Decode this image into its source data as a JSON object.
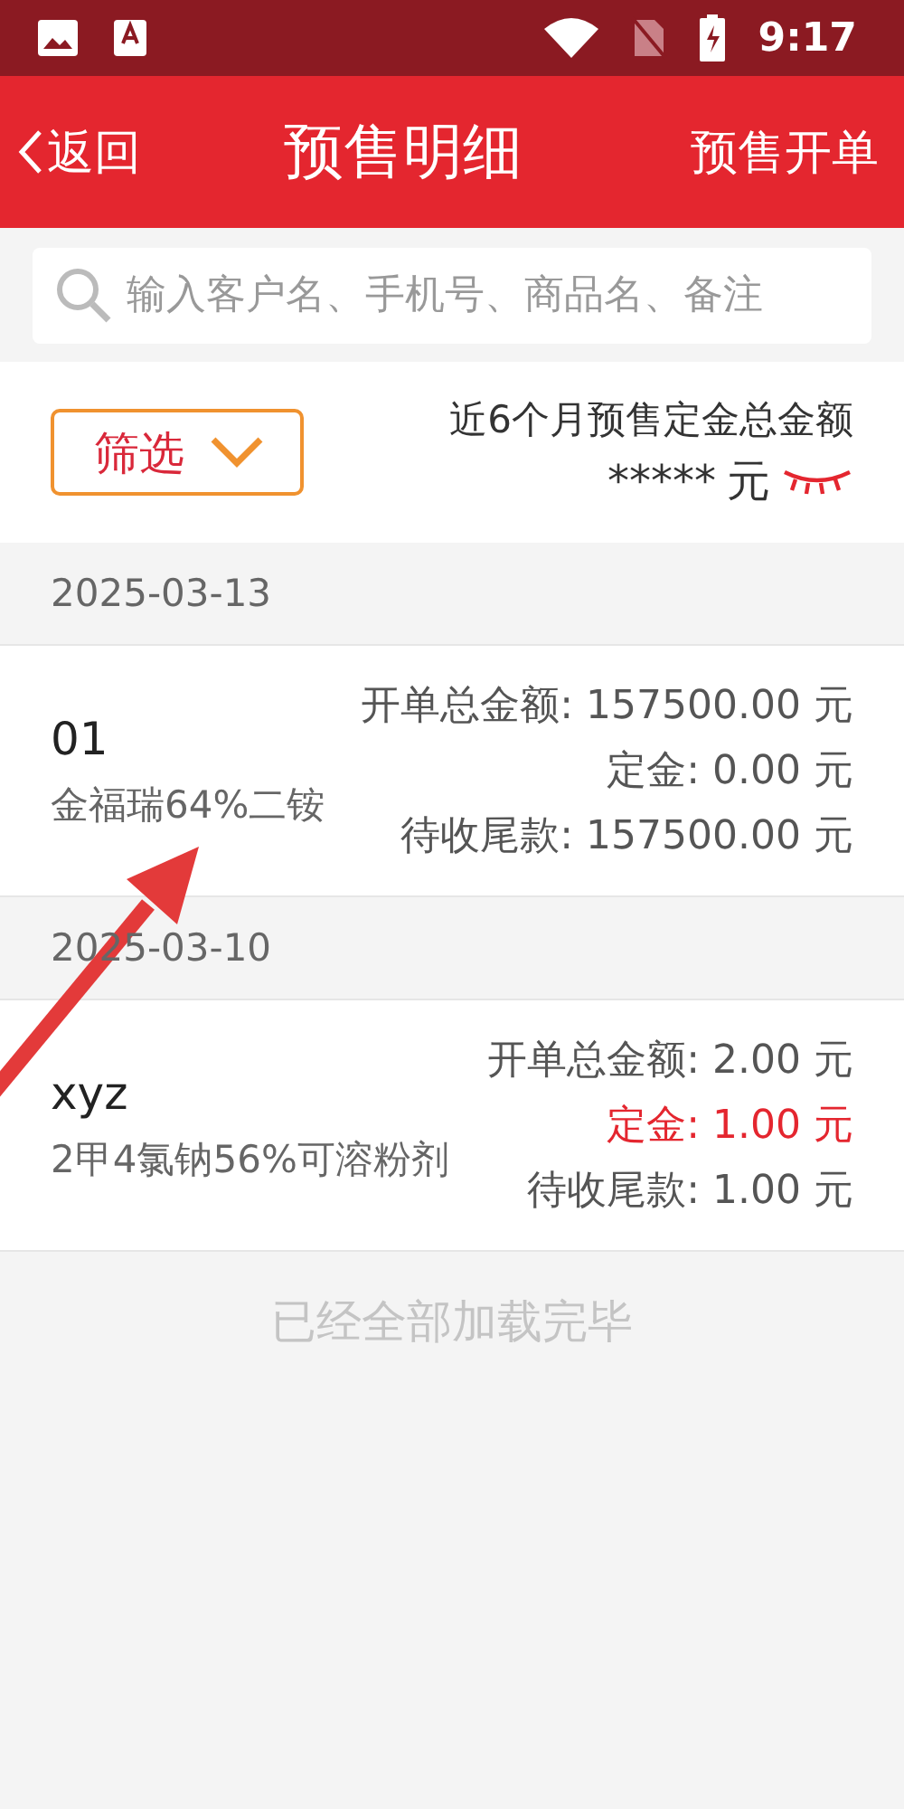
{
  "status_bar": {
    "time": "9:17"
  },
  "header": {
    "back": "返回",
    "title": "预售明细",
    "action": "预售开单"
  },
  "search": {
    "placeholder": "输入客户名、手机号、商品名、备注"
  },
  "summary": {
    "filter": "筛选",
    "label": "近6个月预售定金总金额",
    "amount": "*****",
    "unit": "元",
    "hidden": true
  },
  "groups": [
    {
      "date": "2025-03-13",
      "orders": [
        {
          "customer": "01",
          "product": "金福瑞64%二铵",
          "lines": [
            {
              "text": "开单总金额: 157500.00 元",
              "highlight": false
            },
            {
              "text": "定金: 0.00 元",
              "highlight": false
            },
            {
              "text": "待收尾款: 157500.00 元",
              "highlight": false
            }
          ]
        }
      ]
    },
    {
      "date": "2025-03-10",
      "orders": [
        {
          "customer": "xyz",
          "product": "2甲4氯钠56%可溶粉剂",
          "lines": [
            {
              "text": "开单总金额: 2.00 元",
              "highlight": false
            },
            {
              "text": "定金: 1.00 元",
              "highlight": true
            },
            {
              "text": "待收尾款: 1.00 元",
              "highlight": false
            }
          ]
        }
      ]
    }
  ],
  "footer": "已经全部加载完毕"
}
